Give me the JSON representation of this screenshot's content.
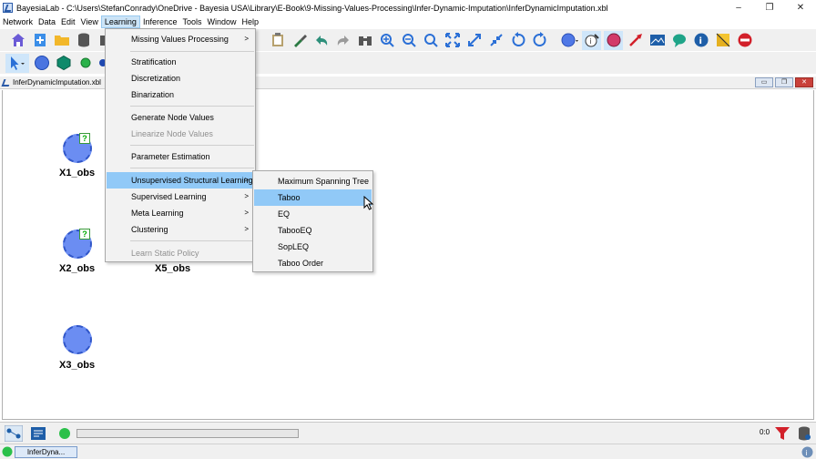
{
  "window": {
    "title": "BayesiaLab - C:\\Users\\StefanConrady\\OneDrive - Bayesia USA\\Library\\E-Book\\9-Missing-Values-Processing\\Infer-Dynamic-Imputation\\InferDynamicImputation.xbl",
    "minimize": "–",
    "restore": "❐",
    "close": "✕"
  },
  "menubar": [
    {
      "label": "Network"
    },
    {
      "label": "Data"
    },
    {
      "label": "Edit"
    },
    {
      "label": "View"
    },
    {
      "label": "Learning",
      "active": true
    },
    {
      "label": "Inference"
    },
    {
      "label": "Tools"
    },
    {
      "label": "Window"
    },
    {
      "label": "Help"
    }
  ],
  "document": {
    "tab_label": "InferDynamicImputation.xbl",
    "ctrl_min": "▭",
    "ctrl_restore": "❐",
    "ctrl_close": "✕"
  },
  "learning_menu": [
    {
      "label": "Missing Values Processing",
      "submenu": true
    },
    {
      "label": "Stratification"
    },
    {
      "label": "Discretization"
    },
    {
      "label": "Binarization"
    },
    {
      "label": "Generate Node Values"
    },
    {
      "label": "Linearize Node Values",
      "disabled": true
    },
    {
      "label": "Parameter Estimation"
    },
    {
      "label": "Unsupervised Structural Learning",
      "submenu": true,
      "highlighted": true
    },
    {
      "label": "Supervised Learning",
      "submenu": true
    },
    {
      "label": "Meta Learning",
      "submenu": true
    },
    {
      "label": "Clustering",
      "submenu": true
    },
    {
      "label": "Learn Static Policy",
      "disabled": true
    }
  ],
  "unsupervised_submenu": [
    {
      "label": "Maximum Spanning Tree"
    },
    {
      "label": "Taboo",
      "highlighted": true
    },
    {
      "label": "EQ"
    },
    {
      "label": "TabooEQ"
    },
    {
      "label": "SopLEQ"
    },
    {
      "label": "Taboo Order"
    }
  ],
  "nodes": [
    {
      "label": "X1_obs",
      "has_question": true,
      "question": "?"
    },
    {
      "label": "X2_obs",
      "has_question": true,
      "question": "?"
    },
    {
      "label": "X3_obs",
      "has_question": false
    },
    {
      "label": "X5_obs",
      "has_question": false
    }
  ],
  "statusbar": {
    "progress": 0,
    "counter": "0:0"
  },
  "taskbar": {
    "task_label": "InferDyna..."
  },
  "colors": {
    "node_fill": "#6b8df2",
    "menu_highlight": "#91c9f7",
    "menubar_active": "#cce4f7"
  }
}
